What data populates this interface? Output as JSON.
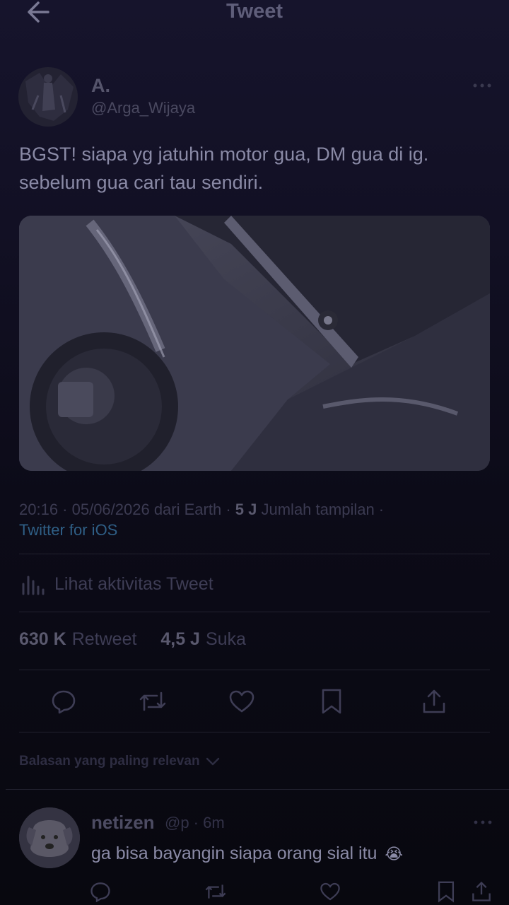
{
  "header": {
    "title": "Tweet"
  },
  "author": {
    "name": "A.",
    "handle": "@Arga_Wijaya"
  },
  "tweet": {
    "line1": "BGST! siapa yg jatuhin motor gua, DM gua di ig.",
    "line2": "sebelum gua cari tau sendiri."
  },
  "meta": {
    "time_date": "20:16 · 05/06/2026 dari Earth ·",
    "views_count": "5 J",
    "views_label": "Jumlah tampilan ·",
    "source": "Twitter for iOS"
  },
  "activity": {
    "label": "Lihat aktivitas Tweet"
  },
  "stats": {
    "retweets_count": "630 K",
    "retweets_label": "Retweet",
    "likes_count": "4,5 J",
    "likes_label": "Suka"
  },
  "replies_sort": {
    "label": "Balasan yang paling relevan"
  },
  "reply": {
    "name": "netizen",
    "meta": "@p · 6m",
    "text": "ga bisa bayangin siapa orang sial itu",
    "emoji": "😭"
  },
  "colors": {
    "link": "#2f5f86",
    "background_top": "#16142c",
    "background_bottom": "#08080f"
  }
}
